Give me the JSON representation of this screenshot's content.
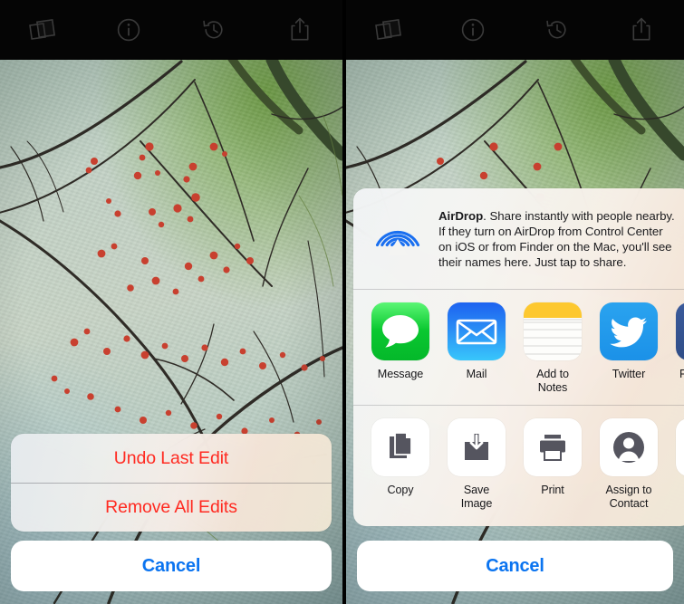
{
  "toolbar": {
    "items": [
      {
        "name": "photos-stack-icon",
        "label": "Photos"
      },
      {
        "name": "info-icon",
        "label": "Info"
      },
      {
        "name": "history-revert-icon",
        "label": "Revert"
      },
      {
        "name": "share-icon",
        "label": "Share"
      }
    ]
  },
  "left_panel": {
    "action_sheet": {
      "options": [
        {
          "label": "Undo Last Edit",
          "style": "destructive"
        },
        {
          "label": "Remove All Edits",
          "style": "destructive"
        }
      ],
      "cancel_label": "Cancel"
    }
  },
  "right_panel": {
    "share_sheet": {
      "airdrop": {
        "title": "AirDrop",
        "body": ". Share instantly with people nearby. If they turn on AirDrop from Control Center on iOS or from Finder on the Mac, you'll see their names here. Just tap to share.",
        "icon": "airdrop-icon"
      },
      "apps": [
        {
          "label": "Message",
          "icon": "messages-app-icon"
        },
        {
          "label": "Mail",
          "icon": "mail-app-icon"
        },
        {
          "label": "Add to Notes",
          "icon": "notes-app-icon"
        },
        {
          "label": "Twitter",
          "icon": "twitter-app-icon"
        },
        {
          "label": "F",
          "icon": "facebook-app-icon"
        }
      ],
      "actions": [
        {
          "label": "Copy",
          "icon": "copy-icon"
        },
        {
          "label": "Save Image",
          "icon": "save-image-icon"
        },
        {
          "label": "Print",
          "icon": "print-icon"
        },
        {
          "label": "Assign to Contact",
          "icon": "contact-icon"
        },
        {
          "label": "",
          "icon": "more-action-icon"
        }
      ],
      "cancel_label": "Cancel"
    }
  },
  "colors": {
    "destructive_red": "#ff2a21",
    "tint_blue": "#0b74f0",
    "airdrop_blue": "#1a6ff0",
    "toolbar_black": "#050505",
    "action_glyph_gray": "#55555f"
  }
}
